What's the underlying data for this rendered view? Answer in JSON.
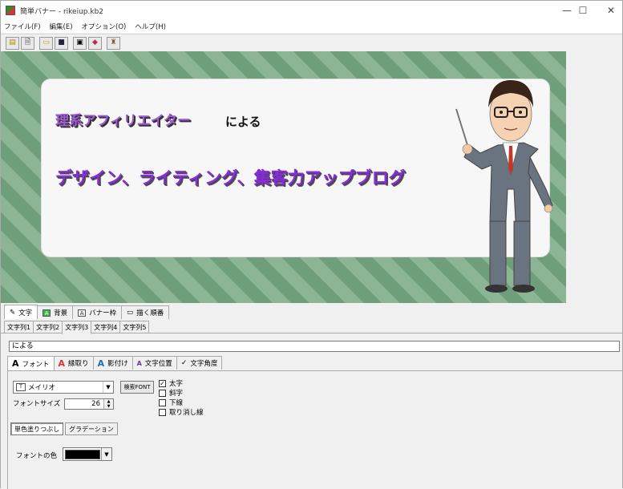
{
  "window": {
    "title": "簡単バナー - rikeiup.kb2",
    "minimize": "—",
    "maximize": "☐",
    "close": "✕"
  },
  "menu": [
    "ファイル(F)",
    "編集(E)",
    "オプション(O)",
    "ヘルプ(H)"
  ],
  "toolbar": {
    "buttons": [
      {
        "name": "new-icon",
        "glyph": "▤"
      },
      {
        "name": "document-icon",
        "glyph": "🗎"
      },
      {
        "name": "open-folder-icon",
        "glyph": "▭"
      },
      {
        "name": "save-icon",
        "glyph": "■"
      },
      {
        "name": "export-icon",
        "glyph": "▣"
      },
      {
        "name": "book-icon",
        "glyph": "◆"
      },
      {
        "name": "bottle-icon",
        "glyph": "♜"
      }
    ]
  },
  "banner": {
    "title": "理系アフィリエイター",
    "by": "による",
    "subtitle": "デザイン、ライティング、集客力アップブログ"
  },
  "main_tabs": [
    {
      "label": "文字",
      "icon": "✎",
      "active": true
    },
    {
      "label": "背景",
      "icon": "A",
      "active": false
    },
    {
      "label": "バナー枠",
      "icon": "A",
      "active": false
    },
    {
      "label": "描く順番",
      "icon": "▭",
      "active": false
    }
  ],
  "string_tabs": [
    {
      "label": "文字列1",
      "active": false
    },
    {
      "label": "文字列2",
      "active": false
    },
    {
      "label": "文字列3",
      "active": true
    },
    {
      "label": "文字列4",
      "active": false
    },
    {
      "label": "文字列5",
      "active": false
    }
  ],
  "text_value": "による",
  "style_tabs": [
    {
      "label": "フォント",
      "icon": "A",
      "active": true
    },
    {
      "label": "縁取り",
      "icon": "A",
      "active": false
    },
    {
      "label": "影付け",
      "icon": "A",
      "active": false
    },
    {
      "label": "文字位置",
      "icon": "A",
      "active": false
    },
    {
      "label": "文字角度",
      "icon": "✓",
      "active": false
    }
  ],
  "font": {
    "selected": "メイリオ",
    "search_button": "検索FONT",
    "size_label": "フォントサイズ",
    "size_value": "26",
    "options": [
      {
        "label": "太字",
        "checked": true
      },
      {
        "label": "斜字",
        "checked": false
      },
      {
        "label": "下線",
        "checked": false
      },
      {
        "label": "取り消し線",
        "checked": false
      }
    ],
    "fill_buttons": [
      {
        "label": "単色塗りつぶし",
        "active": true
      },
      {
        "label": "グラデーション",
        "active": false
      }
    ],
    "color_label": "フォントの色",
    "color": "#000000"
  },
  "colors": {
    "banner_stripe_a": "#6f9e7a",
    "banner_stripe_b": "#8cb596",
    "title_purple": "#a15ad8",
    "subtitle_purple": "#8a2be2"
  }
}
